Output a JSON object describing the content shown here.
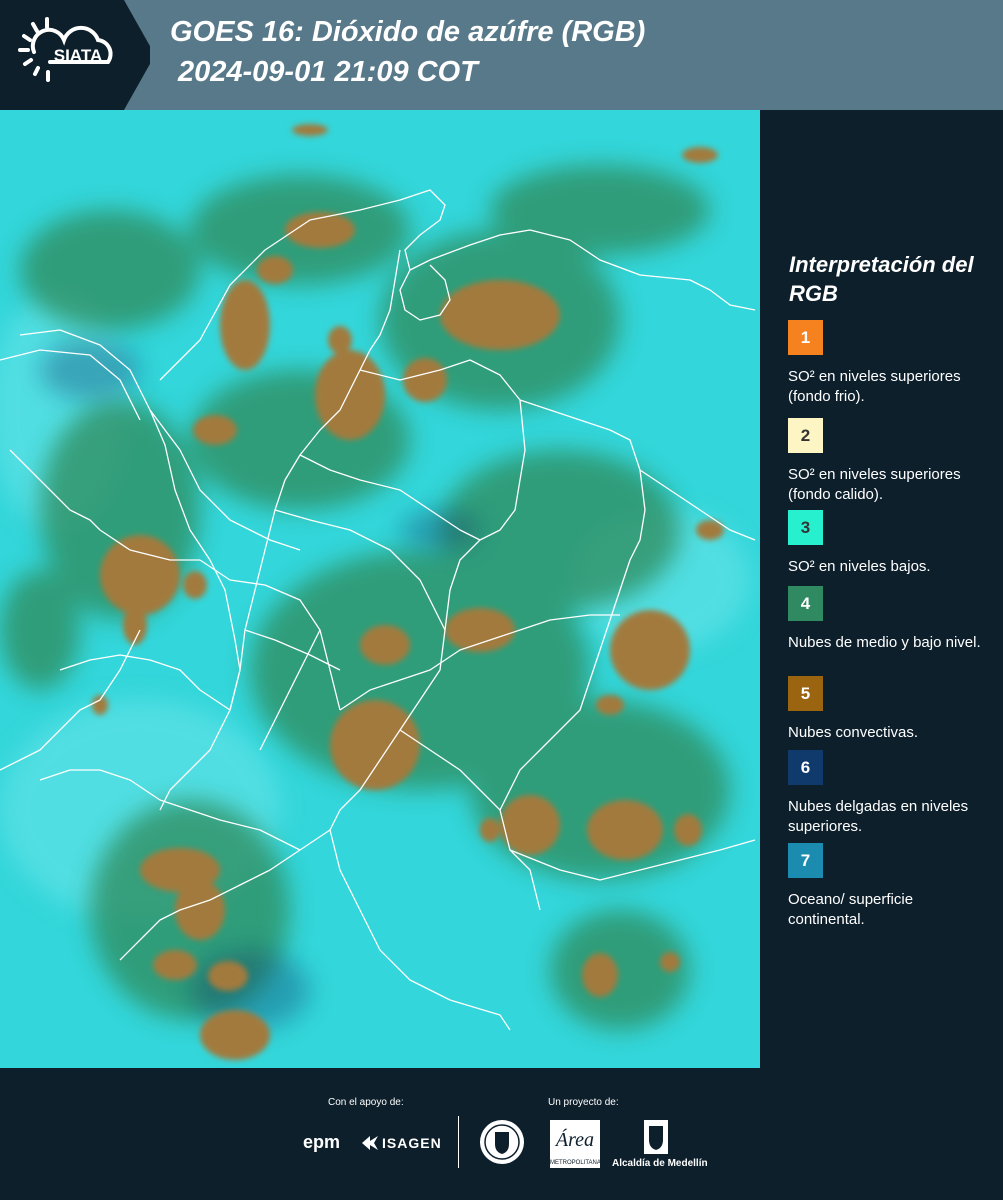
{
  "header": {
    "logo_text": "SIATA",
    "title_line1": "GOES 16: Dióxido de azúfre (RGB)",
    "title_line2": "2024-09-01 21:09 COT",
    "background_color": "#587989"
  },
  "map": {
    "image_description_icon": "satellite-rgb-image",
    "ocean_color": "#33d6da",
    "cloud_color": "#a27a3c",
    "vegetation_cloud_color": "#2f8a5a",
    "border_color": "#ffffff"
  },
  "legend": {
    "title": "Interpretación del RGB",
    "items": [
      {
        "number": "1",
        "color": "#f5821f",
        "text_color": "#ffffff",
        "label": "SO² en niveles superiores (fondo frio)."
      },
      {
        "number": "2",
        "color": "#fdf5c4",
        "text_color": "#333333",
        "label": "SO² en niveles superiores (fondo calido)."
      },
      {
        "number": "3",
        "color": "#27f0cf",
        "text_color": "#333333",
        "label": "SO² en niveles bajos."
      },
      {
        "number": "4",
        "color": "#2f8a61",
        "text_color": "#ffffff",
        "label": "Nubes de medio y bajo nivel."
      },
      {
        "number": "5",
        "color": "#9a6411",
        "text_color": "#ffffff",
        "label": "Nubes convectivas."
      },
      {
        "number": "6",
        "color": "#0f3a6b",
        "text_color": "#ffffff",
        "label": "Nubes delgadas en niveles superiores."
      },
      {
        "number": "7",
        "color": "#1b8cb0",
        "text_color": "#ffffff",
        "label": "Oceano/ superficie continental."
      }
    ]
  },
  "footer": {
    "support_label": "Con el apoyo de:",
    "project_label": "Un proyecto de:",
    "sponsors": [
      "epm",
      "ISAGEN"
    ],
    "partners": [
      "METROPOLITANA",
      "Alcaldía de Medellín"
    ]
  }
}
